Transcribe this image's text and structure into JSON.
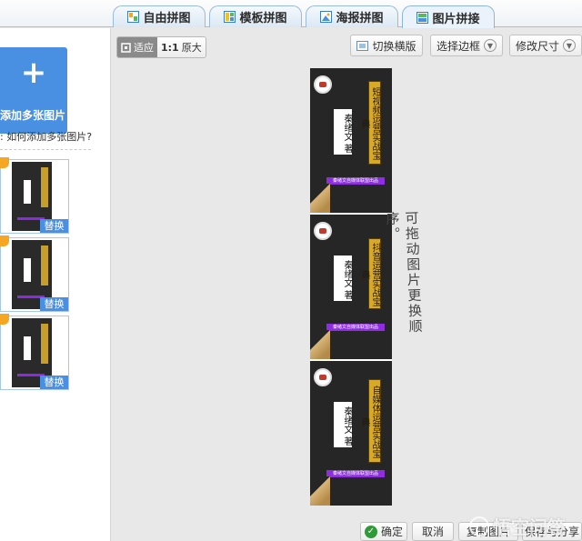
{
  "tabs": [
    {
      "label": "自由拼图",
      "icon": "freeform-collage-icon"
    },
    {
      "label": "模板拼图",
      "icon": "template-collage-icon"
    },
    {
      "label": "海报拼图",
      "icon": "poster-collage-icon"
    },
    {
      "label": "图片拼接",
      "icon": "image-join-icon",
      "active": true
    }
  ],
  "sidebar": {
    "add_label": "添加多张图片",
    "help_prefix": ":",
    "help_link": "如何添加多张图片?",
    "thumbs": [
      {
        "num": "1",
        "swap": "替换"
      },
      {
        "num": "2",
        "swap": "替换"
      },
      {
        "num": "3",
        "swap": "替换"
      }
    ]
  },
  "toolbar": {
    "fit_label": "适应",
    "original_label": "原大",
    "original_prefix": "1:1",
    "switch_label": "切换横版",
    "border_label": "选择边框",
    "resize_label": "修改尺寸"
  },
  "panels": [
    {
      "title": "短视频运营实战宝典",
      "author": "秦绪文 著",
      "publisher": "秦绪文自媒体联盟出品"
    },
    {
      "title": "抖音运营实战宝典",
      "author": "秦绪文 著",
      "publisher": "秦绪文自媒体联盟出品"
    },
    {
      "title": "自媒体运营实战宝典",
      "author": "秦绪文 著",
      "publisher": "秦绪文自媒体联盟出品"
    }
  ],
  "note": "可拖动图片更换顺序。",
  "bottom": {
    "confirm": "确定",
    "cancel": "取消",
    "copy": "复制图片",
    "save": "保存与分享"
  },
  "watermark": "悟空问答",
  "colors": {
    "accent": "#4a90e2",
    "purple_bar": "#8e2ee0",
    "gold": "#d8a927",
    "ok_green": "#2e9b38"
  }
}
